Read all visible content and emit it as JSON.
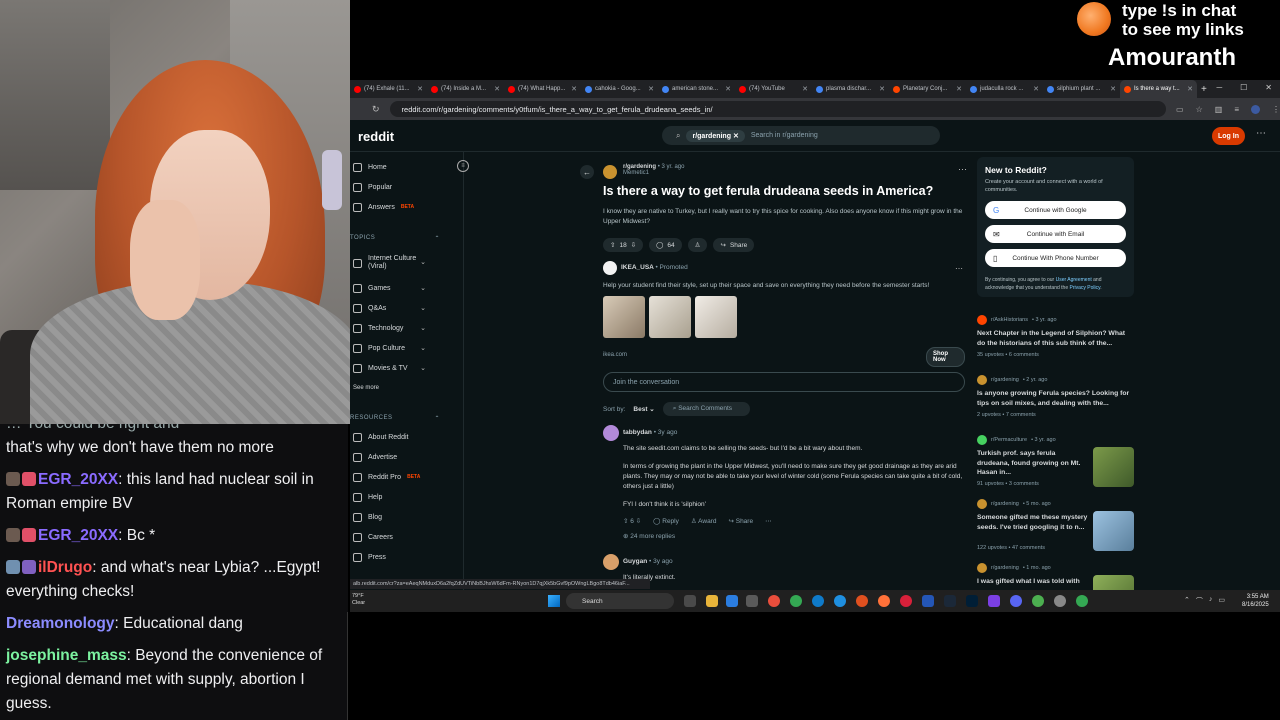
{
  "overlay": {
    "line1": "type !s in chat",
    "line2": "to see my links",
    "name": "Amouranth"
  },
  "chat": {
    "partial_top": "that's why we don't have them no more",
    "partial_top_prefix": "… You could be right and",
    "messages": [
      {
        "name": "EGR_20XX",
        "color": "#8a6bff",
        "text": ": this land had nuclear soil in Roman empire BV"
      },
      {
        "name": "EGR_20XX",
        "color": "#8a6bff",
        "text": ": Bc *"
      },
      {
        "name": "ilDrugo",
        "color": "#ff5252",
        "text": ": and what's near Lybia? ...Egypt! everything checks!"
      },
      {
        "name": "Dreamonology",
        "color": "#8c8cff",
        "text": ": Educational dang"
      },
      {
        "name": "josephine_mass",
        "color": "#7cf2a0",
        "text": ": Beyond the convenience of regional demand met with supply, abortion I guess."
      }
    ]
  },
  "browser": {
    "tabs": [
      {
        "label": "(74) Exhale (11...",
        "color": "#ff0000"
      },
      {
        "label": "(74) Inside a M...",
        "color": "#ff0000"
      },
      {
        "label": "(74) What Happ...",
        "color": "#ff0000"
      },
      {
        "label": "cahokia - Goog...",
        "color": "#4285f4"
      },
      {
        "label": "american stone...",
        "color": "#4285f4"
      },
      {
        "label": "(74) YouTube",
        "color": "#ff0000"
      },
      {
        "label": "plasma dischar...",
        "color": "#4285f4"
      },
      {
        "label": "Planetary Conj...",
        "color": "#ff4500"
      },
      {
        "label": "judaculla rock ...",
        "color": "#4285f4"
      },
      {
        "label": "silphium plant ...",
        "color": "#4285f4"
      },
      {
        "label": "Is there a way t...",
        "color": "#ff4500"
      }
    ],
    "url": "reddit.com/r/gardening/comments/y0tfum/is_there_a_way_to_get_ferula_drudeana_seeds_in/",
    "status_url": "alb.reddit.com/cr?za=eAeqNMduxD6a2fqZdUVTiNbBJhsW6dFm-RNyon1D7qjXk5bGvf9pOWngLBgo8Tdb46iaF..."
  },
  "reddit": {
    "logo": "reddit",
    "search_chip": "r/gardening",
    "search_placeholder": "Search in r/gardening",
    "login": "Log In",
    "nav": {
      "home": "Home",
      "popular": "Popular",
      "answers": "Answers",
      "beta": "BETA",
      "topics": "TOPICS",
      "internet_culture": "Internet Culture (Viral)",
      "games": "Games",
      "qas": "Q&As",
      "technology": "Technology",
      "pop_culture": "Pop Culture",
      "movies_tv": "Movies & TV",
      "see_more": "See more",
      "resources": "RESOURCES",
      "about": "About Reddit",
      "advertise": "Advertise",
      "reddit_pro": "Reddit Pro",
      "help": "Help",
      "blog": "Blog",
      "careers": "Careers",
      "press": "Press"
    },
    "post": {
      "subreddit": "r/gardening",
      "time": "• 3 yr. ago",
      "user": "Memetic1",
      "title": "Is there a way to get ferula drudeana seeds in America?",
      "body": "I know they are native to Turkey, but I really want to try this spice for cooking. Also does anyone know if this might grow in the Upper Midwest?",
      "votes": "18",
      "comments": "64",
      "share": "Share"
    },
    "ad": {
      "name": "IKEA_USA",
      "promoted": "• Promoted",
      "text": "Help your student find their style, set up their space and save on everything they need before the semester starts!",
      "domain": "ikea.com",
      "cta": "Shop Now"
    },
    "join_placeholder": "Join the conversation",
    "sort_label": "Sort by:",
    "sort_value": "Best",
    "search_comments": "Search Comments",
    "comments": [
      {
        "user": "tabbydan",
        "time": "• 3y ago",
        "p1": "The site seedit.com claims to be selling the seeds- but I'd be a bit wary about them.",
        "p2": "In terms of growing the plant in the Upper Midwest, you'll need to make sure they get good drainage as they are arid plants. They may or may not be able to take your level of winter cold (some Ferula species can take quite a bit of cold, others just a little)",
        "p3": "FYI I don't think it is 'silphion'",
        "votes": "6",
        "reply": "Reply",
        "award": "Award",
        "share": "Share",
        "more": "24 more replies"
      },
      {
        "user": "Guygan",
        "time": "• 3y ago",
        "p1": "It's literally extinct."
      }
    ],
    "new_box": {
      "title": "New to Reddit?",
      "desc": "Create your account and connect with a world of communities.",
      "google": "Continue with Google",
      "email": "Continue with Email",
      "phone": "Continue With Phone Number",
      "legal_pre": "By continuing, you agree to our",
      "user_agreement": "User Agreement",
      "legal_mid": "and acknowledge that you understand the",
      "privacy": "Privacy Policy"
    },
    "related": [
      {
        "sub": "r/AskHistorians",
        "time": "• 3 yr. ago",
        "title": "Next Chapter in the Legend of Silphion? What do the historians of this sub think of the...",
        "stats": "35 upvotes • 6 comments",
        "color": "#ff4500"
      },
      {
        "sub": "r/gardening",
        "time": "• 2 yr. ago",
        "title": "Is anyone growing Ferula species? Looking for tips on soil mixes, and dealing with the...",
        "stats": "2 upvotes • 7 comments",
        "color": "#c9922f"
      },
      {
        "sub": "r/Permaculture",
        "time": "• 3 yr. ago",
        "title": "Turkish prof. says ferula drudeana, found growing on Mt. Hasan in...",
        "stats": "91 upvotes • 3 comments",
        "color": "#46d160"
      },
      {
        "sub": "r/gardening",
        "time": "• 5 mo. ago",
        "title": "Someone gifted me these mystery seeds. I've tried googling it to n...",
        "stats": "122 upvotes • 47 comments",
        "color": "#c9922f"
      },
      {
        "sub": "r/gardening",
        "time": "• 1 mo. ago",
        "title": "I was gifted what I was told with",
        "stats": "",
        "color": "#c9922f"
      }
    ]
  },
  "taskbar": {
    "temp": "79°F",
    "weather": "Clear",
    "search": "Search",
    "time": "3:55 AM",
    "date": "8/16/2025"
  }
}
